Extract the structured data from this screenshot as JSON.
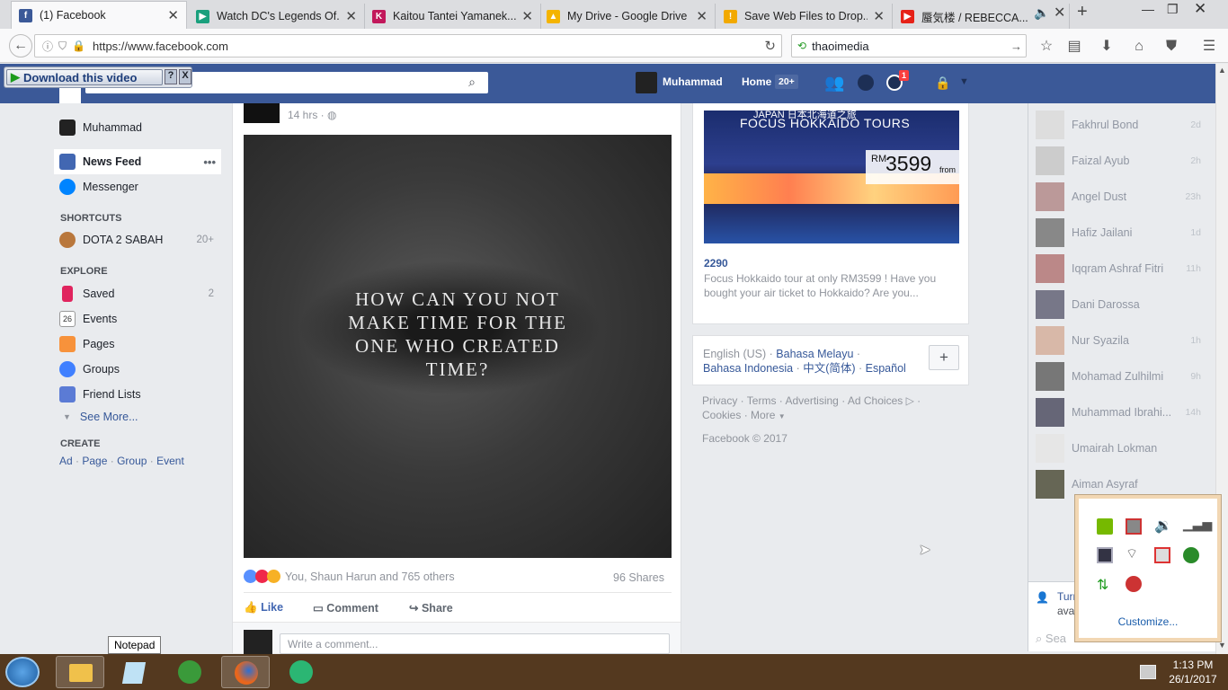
{
  "browser": {
    "tabs": [
      {
        "title": "(1) Facebook",
        "fav": "f",
        "color": "#3b5998"
      },
      {
        "title": "Watch DC's Legends Of...",
        "fav": "▶",
        "color": "#1aa07d"
      },
      {
        "title": "Kaitou Tantei Yamanek...",
        "fav": "K",
        "color": "#c2185b"
      },
      {
        "title": "My Drive - Google Drive",
        "fav": "▲",
        "color": "#f4b400"
      },
      {
        "title": "Save Web Files to Drop...",
        "fav": "!",
        "color": "#f2a900"
      },
      {
        "title": "蜃気楼 / REBECCA...",
        "fav": "▶",
        "color": "#e62117"
      }
    ],
    "url": "https://www.facebook.com",
    "search_text": "thaoimedia"
  },
  "download_bar": {
    "label": "Download this video"
  },
  "fbbar": {
    "profile": "Muhammad",
    "home": "Home",
    "home_badge": "20+",
    "notif_badge": "1"
  },
  "left": {
    "profile": "Muhammad",
    "news_feed": "News Feed",
    "news_more": "•••",
    "messenger": "Messenger",
    "shortcuts_title": "SHORTCUTS",
    "dota": "DOTA 2 SABAH",
    "dota_count": "20+",
    "explore_title": "EXPLORE",
    "saved": "Saved",
    "saved_count": "2",
    "events": "Events",
    "events_day": "26",
    "pages": "Pages",
    "groups": "Groups",
    "friend_lists": "Friend Lists",
    "see_more": "See More...",
    "create_title": "CREATE",
    "create_ad": "Ad",
    "create_page": "Page",
    "create_group": "Group",
    "create_event": "Event"
  },
  "post": {
    "time": "14 hrs ·",
    "image_text": "HOW CAN YOU NOT MAKE TIME FOR THE ONE WHO CREATED TIME?",
    "reactions": "You, Shaun Harun and 765 others",
    "shares": "96 Shares",
    "like": "Like",
    "comment": "Comment",
    "share": "Share",
    "comment_placeholder": "Write a comment..."
  },
  "ad": {
    "banner_title": "FOCUS HOKKAIDO TOURS",
    "banner_top": "JAPAN 日本北海道之旅",
    "price_prefix": "RM",
    "price": "3599",
    "price_suffix": "from",
    "title": "2290",
    "desc": "Focus Hokkaido tour at only RM3599 ! Have you bought your air ticket to Hokkaido? Are you..."
  },
  "lang": {
    "l1": "English (US)",
    "l2": "Bahasa Melayu",
    "l3": "Bahasa Indonesia",
    "l4": "中文(简体)",
    "l5": "Español"
  },
  "footer": {
    "privacy": "Privacy",
    "terms": "Terms",
    "advertising": "Advertising",
    "adchoices": "Ad Choices",
    "cookies": "Cookies",
    "more": "More",
    "copyright": "Facebook © 2017"
  },
  "chat": [
    {
      "name": "Fakhrul Bond",
      "time": "2d"
    },
    {
      "name": "Faizal Ayub",
      "time": "2h"
    },
    {
      "name": "Angel Dust",
      "time": "23h"
    },
    {
      "name": "Hafiz Jailani",
      "time": "1d"
    },
    {
      "name": "Iqqram Ashraf Fitri",
      "time": "11h"
    },
    {
      "name": "Dani Darossa",
      "time": ""
    },
    {
      "name": "Nur Syazila",
      "time": "1h"
    },
    {
      "name": "Mohamad Zulhilmi",
      "time": "9h"
    },
    {
      "name": "Muhammad Ibrahi...",
      "time": "14h"
    },
    {
      "name": "Umairah Lokman",
      "time": ""
    },
    {
      "name": "Aiman Asyraf",
      "time": ""
    }
  ],
  "chat_bottom": {
    "turn": "Turn",
    "avail": "ava",
    "search": "Sea"
  },
  "tray": {
    "customize": "Customize..."
  },
  "taskbar": {
    "tooltip": "Notepad",
    "time": "1:13 PM",
    "date": "26/1/2017"
  }
}
